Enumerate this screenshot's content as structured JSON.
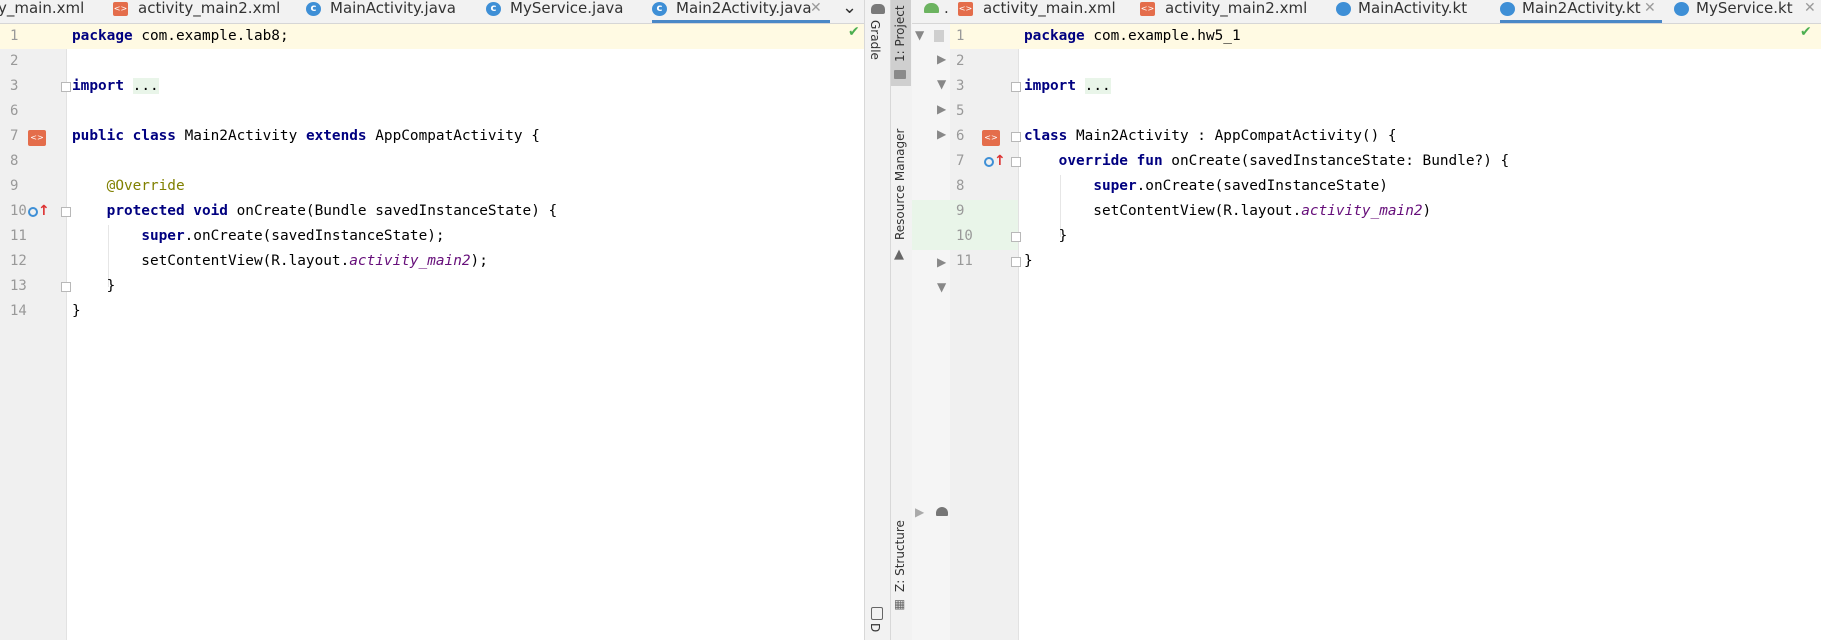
{
  "left_editor": {
    "tabs": [
      {
        "label": "y_main.xml",
        "icon": "xml-file-icon"
      },
      {
        "label": "activity_main2.xml",
        "icon": "xml-file-icon"
      },
      {
        "label": "MainActivity.java",
        "icon": "java-class-icon"
      },
      {
        "label": "MyService.java",
        "icon": "java-class-icon"
      },
      {
        "label": "Main2Activity.java",
        "icon": "java-class-icon",
        "active": true
      }
    ],
    "tab_overflow": "⌄",
    "lines": [
      {
        "n": "1",
        "html": "<span class='kw'>package</span> com.example.lab8;"
      },
      {
        "n": "2",
        "html": ""
      },
      {
        "n": "3",
        "html": "<span class='kw'>import</span> <span class='fold-bg'>...</span>"
      },
      {
        "n": "6",
        "html": ""
      },
      {
        "n": "7",
        "html": "<span class='kw'>public class</span> Main2Activity <span class='kw'>extends</span> AppCompatActivity {"
      },
      {
        "n": "8",
        "html": ""
      },
      {
        "n": "9",
        "html": "    <span class='ann'>@Override</span>"
      },
      {
        "n": "10",
        "html": "    <span class='kw'>protected void</span> onCreate(Bundle savedInstanceState) {"
      },
      {
        "n": "11",
        "html": "        <span class='kw'>super</span>.onCreate(savedInstanceState);"
      },
      {
        "n": "12",
        "html": "        setContentView(R.layout.<span class='field'>activity_main2</span>);"
      },
      {
        "n": "13",
        "html": "    }"
      },
      {
        "n": "14",
        "html": "}"
      }
    ]
  },
  "tool_window_labels": {
    "gradle": "Gradle",
    "project": "1: Project",
    "resource_manager": "Resource Manager",
    "structure": "Z: Structure",
    "device": "D"
  },
  "right_editor": {
    "tabs": [
      {
        "label": ".",
        "icon": "android-icon"
      },
      {
        "label": "activity_main.xml",
        "icon": "xml-file-icon"
      },
      {
        "label": "activity_main2.xml",
        "icon": "xml-file-icon"
      },
      {
        "label": "MainActivity.kt",
        "icon": "kotlin-class-icon"
      },
      {
        "label": "Main2Activity.kt",
        "icon": "kotlin-class-icon",
        "active": true
      },
      {
        "label": "MyService.kt",
        "icon": "kotlin-class-icon"
      }
    ],
    "lines": [
      {
        "n": "1",
        "html": "<span class='kw'>package</span> com.example.hw5_1"
      },
      {
        "n": "2",
        "html": ""
      },
      {
        "n": "3",
        "html": "<span class='kw'>import</span> <span class='fold-bg'>...</span>"
      },
      {
        "n": "5",
        "html": ""
      },
      {
        "n": "6",
        "html": "<span class='kw'>class</span> Main2Activity : AppCompatActivity() {"
      },
      {
        "n": "7",
        "html": "    <span class='kw'>override fun</span> onCreate(savedInstanceState: Bundle?) {"
      },
      {
        "n": "8",
        "html": "        <span class='kw'>super</span>.onCreate(savedInstanceState)"
      },
      {
        "n": "9",
        "html": "        setContentView(R.layout.<span class='field'>activity_main2</span>)"
      },
      {
        "n": "10",
        "html": "    }"
      },
      {
        "n": "11",
        "html": "}"
      }
    ]
  },
  "colors": {
    "keyword": "#000080",
    "annotation": "#808000",
    "field": "#660e7a",
    "active_tab_underline": "#4a88c7",
    "current_line": "#fffae3"
  }
}
